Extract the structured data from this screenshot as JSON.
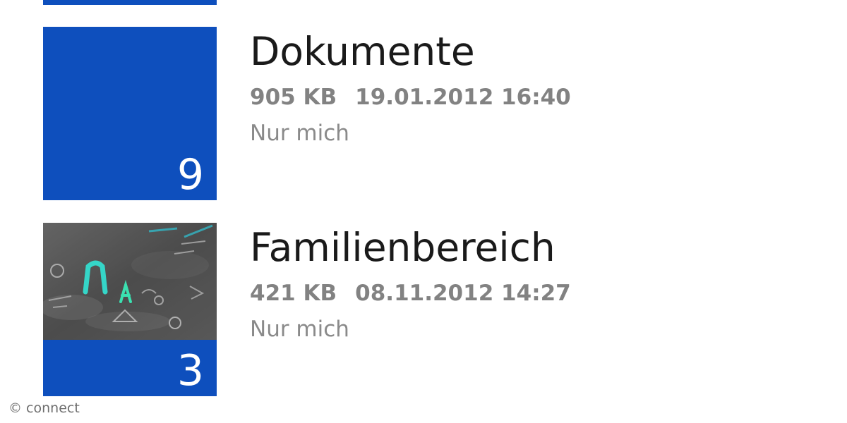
{
  "colors": {
    "tile_blue": "#0e4fbd",
    "title_text": "#1a1a1a",
    "meta_text": "#828282",
    "count_text": "#ffffff"
  },
  "folders": [
    {
      "name": "Dokumente",
      "size": "905 KB",
      "date": "19.01.2012 16:40",
      "sharing": "Nur mich",
      "count": "9",
      "thumbnail": "none"
    },
    {
      "name": "Familienbereich",
      "size": "421 KB",
      "date": "08.11.2012 14:27",
      "sharing": "Nur mich",
      "count": "3",
      "thumbnail": "chalkboard-photo"
    }
  ],
  "watermark": {
    "text": "© connect"
  }
}
